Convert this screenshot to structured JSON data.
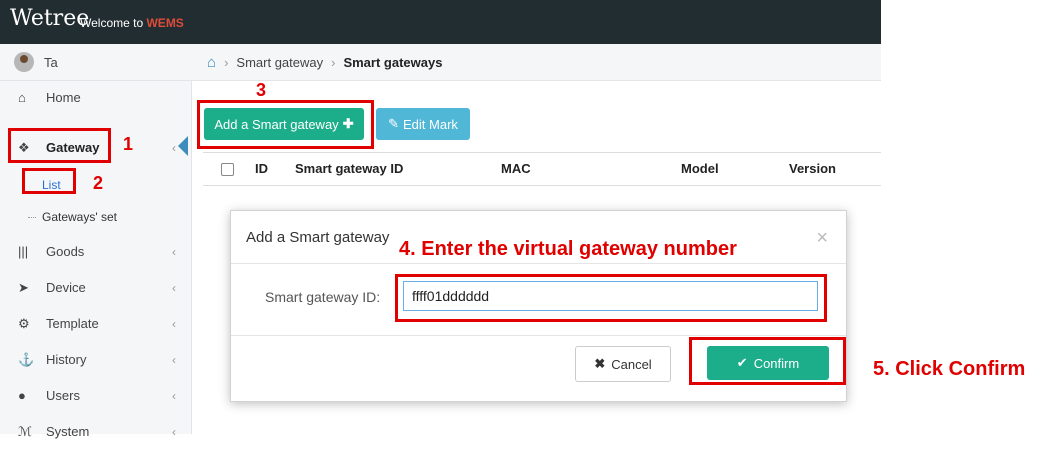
{
  "header": {
    "logo": "Wetree",
    "welcome": "Welcome to",
    "brand": "WEMS"
  },
  "user": {
    "name": "Ta"
  },
  "sidebar": {
    "items": [
      {
        "icon": "home-icon",
        "label": "Home"
      },
      {
        "icon": "gateway-icon",
        "label": "Gateway",
        "active": true
      },
      {
        "icon": "barcode-icon",
        "label": "Goods"
      },
      {
        "icon": "device-icon",
        "label": "Device"
      },
      {
        "icon": "gears-icon",
        "label": "Template"
      },
      {
        "icon": "anchor-icon",
        "label": "History"
      },
      {
        "icon": "user-icon",
        "label": "Users"
      },
      {
        "icon": "system-icon",
        "label": "System"
      }
    ],
    "gateway_sub": [
      "List",
      "Gateways' set"
    ]
  },
  "breadcrumb": {
    "level1": "Smart gateway",
    "level2": "Smart gateways"
  },
  "toolbar": {
    "add_label": "Add a Smart gateway",
    "edit_label": "Edit Mark"
  },
  "table": {
    "columns": [
      "ID",
      "Smart gateway ID",
      "MAC",
      "Model",
      "Version"
    ]
  },
  "modal": {
    "title": "Add a Smart gateway",
    "field_label": "Smart gateway ID:",
    "field_value": "ffff01dddddd",
    "cancel_label": "Cancel",
    "confirm_label": "Confirm"
  },
  "annotations": {
    "n1": "1",
    "n2": "2",
    "n3": "3",
    "n4": "4. Enter the virtual gateway number",
    "n5": "5. Click Confirm",
    "color": "#e00000"
  },
  "colors": {
    "topbar": "#222d32",
    "green": "#1cae8a",
    "info": "#51b7d6",
    "accent": "#3c8dbc"
  }
}
